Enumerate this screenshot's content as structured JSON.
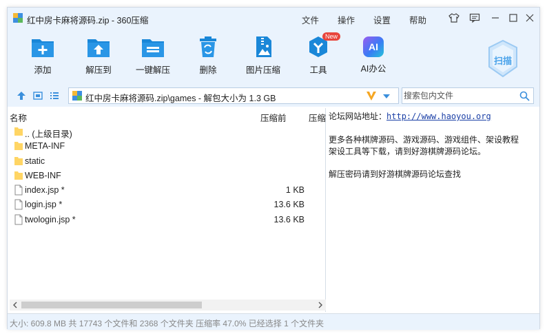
{
  "window": {
    "title": "红中房卡麻将源码.zip - 360压缩"
  },
  "menu": {
    "file": "文件",
    "operate": "操作",
    "settings": "设置",
    "help": "帮助"
  },
  "toolbar": {
    "add": "添加",
    "extract_to": "解压到",
    "one_click": "一键解压",
    "delete": "删除",
    "image_compress": "图片压缩",
    "tools": "工具",
    "tools_badge": "New",
    "ai_office": "AI办公",
    "ai_mark": "AI",
    "scan": "扫描"
  },
  "address": {
    "path": "红中房卡麻将源码.zip\\games - 解包大小为 1.3 GB",
    "search_placeholder": "搜索包内文件"
  },
  "columns": {
    "name": "名称",
    "compressed_before": "压缩前",
    "compressed": "压缩"
  },
  "files": [
    {
      "name": ".. (上级目录)",
      "size": "",
      "type": "folder"
    },
    {
      "name": "META-INF",
      "size": "",
      "type": "folder"
    },
    {
      "name": "static",
      "size": "",
      "type": "folder"
    },
    {
      "name": "WEB-INF",
      "size": "",
      "type": "folder"
    },
    {
      "name": "index.jsp *",
      "size": "1 KB",
      "type": "file"
    },
    {
      "name": "login.jsp *",
      "size": "13.6 KB",
      "type": "file"
    },
    {
      "name": "twologin.jsp *",
      "size": "13.6 KB",
      "type": "file"
    }
  ],
  "notes": {
    "forum_label": "论坛网站地址：",
    "forum_url": "http://www.haoyou.org",
    "line2": "更多各种棋牌源码、游戏源码、游戏组件、架设教程",
    "line3": "架设工具等下载，请到好游棋牌源码论坛。",
    "line4": "解压密码请到好游棋牌源码论坛查找"
  },
  "status": {
    "text": "大小: 609.8 MB 共 17743 个文件和 2368 个文件夹 压缩率 47.0% 已经选择 1 个文件夹"
  },
  "colors": {
    "chrome_bg": "#eaf3fd",
    "icon_blue": "#1a87d8",
    "badge_red": "#e8453c",
    "link_blue": "#1a3fa6"
  }
}
